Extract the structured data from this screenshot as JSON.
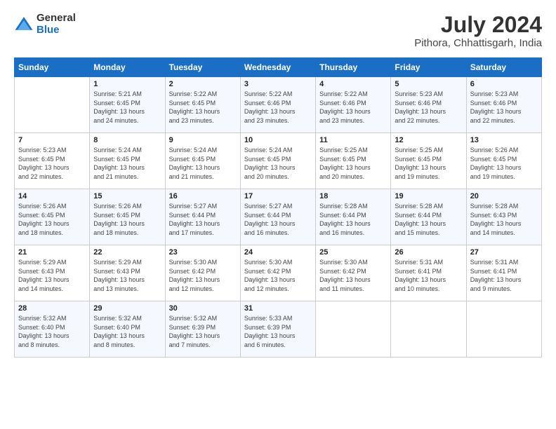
{
  "logo": {
    "general": "General",
    "blue": "Blue"
  },
  "title": "July 2024",
  "location": "Pithora, Chhattisgarh, India",
  "days_of_week": [
    "Sunday",
    "Monday",
    "Tuesday",
    "Wednesday",
    "Thursday",
    "Friday",
    "Saturday"
  ],
  "weeks": [
    [
      {
        "day": "",
        "info": ""
      },
      {
        "day": "1",
        "info": "Sunrise: 5:21 AM\nSunset: 6:45 PM\nDaylight: 13 hours\nand 24 minutes."
      },
      {
        "day": "2",
        "info": "Sunrise: 5:22 AM\nSunset: 6:45 PM\nDaylight: 13 hours\nand 23 minutes."
      },
      {
        "day": "3",
        "info": "Sunrise: 5:22 AM\nSunset: 6:46 PM\nDaylight: 13 hours\nand 23 minutes."
      },
      {
        "day": "4",
        "info": "Sunrise: 5:22 AM\nSunset: 6:46 PM\nDaylight: 13 hours\nand 23 minutes."
      },
      {
        "day": "5",
        "info": "Sunrise: 5:23 AM\nSunset: 6:46 PM\nDaylight: 13 hours\nand 22 minutes."
      },
      {
        "day": "6",
        "info": "Sunrise: 5:23 AM\nSunset: 6:46 PM\nDaylight: 13 hours\nand 22 minutes."
      }
    ],
    [
      {
        "day": "7",
        "info": "Sunrise: 5:23 AM\nSunset: 6:45 PM\nDaylight: 13 hours\nand 22 minutes."
      },
      {
        "day": "8",
        "info": "Sunrise: 5:24 AM\nSunset: 6:45 PM\nDaylight: 13 hours\nand 21 minutes."
      },
      {
        "day": "9",
        "info": "Sunrise: 5:24 AM\nSunset: 6:45 PM\nDaylight: 13 hours\nand 21 minutes."
      },
      {
        "day": "10",
        "info": "Sunrise: 5:24 AM\nSunset: 6:45 PM\nDaylight: 13 hours\nand 20 minutes."
      },
      {
        "day": "11",
        "info": "Sunrise: 5:25 AM\nSunset: 6:45 PM\nDaylight: 13 hours\nand 20 minutes."
      },
      {
        "day": "12",
        "info": "Sunrise: 5:25 AM\nSunset: 6:45 PM\nDaylight: 13 hours\nand 19 minutes."
      },
      {
        "day": "13",
        "info": "Sunrise: 5:26 AM\nSunset: 6:45 PM\nDaylight: 13 hours\nand 19 minutes."
      }
    ],
    [
      {
        "day": "14",
        "info": "Sunrise: 5:26 AM\nSunset: 6:45 PM\nDaylight: 13 hours\nand 18 minutes."
      },
      {
        "day": "15",
        "info": "Sunrise: 5:26 AM\nSunset: 6:45 PM\nDaylight: 13 hours\nand 18 minutes."
      },
      {
        "day": "16",
        "info": "Sunrise: 5:27 AM\nSunset: 6:44 PM\nDaylight: 13 hours\nand 17 minutes."
      },
      {
        "day": "17",
        "info": "Sunrise: 5:27 AM\nSunset: 6:44 PM\nDaylight: 13 hours\nand 16 minutes."
      },
      {
        "day": "18",
        "info": "Sunrise: 5:28 AM\nSunset: 6:44 PM\nDaylight: 13 hours\nand 16 minutes."
      },
      {
        "day": "19",
        "info": "Sunrise: 5:28 AM\nSunset: 6:44 PM\nDaylight: 13 hours\nand 15 minutes."
      },
      {
        "day": "20",
        "info": "Sunrise: 5:28 AM\nSunset: 6:43 PM\nDaylight: 13 hours\nand 14 minutes."
      }
    ],
    [
      {
        "day": "21",
        "info": "Sunrise: 5:29 AM\nSunset: 6:43 PM\nDaylight: 13 hours\nand 14 minutes."
      },
      {
        "day": "22",
        "info": "Sunrise: 5:29 AM\nSunset: 6:43 PM\nDaylight: 13 hours\nand 13 minutes."
      },
      {
        "day": "23",
        "info": "Sunrise: 5:30 AM\nSunset: 6:42 PM\nDaylight: 13 hours\nand 12 minutes."
      },
      {
        "day": "24",
        "info": "Sunrise: 5:30 AM\nSunset: 6:42 PM\nDaylight: 13 hours\nand 12 minutes."
      },
      {
        "day": "25",
        "info": "Sunrise: 5:30 AM\nSunset: 6:42 PM\nDaylight: 13 hours\nand 11 minutes."
      },
      {
        "day": "26",
        "info": "Sunrise: 5:31 AM\nSunset: 6:41 PM\nDaylight: 13 hours\nand 10 minutes."
      },
      {
        "day": "27",
        "info": "Sunrise: 5:31 AM\nSunset: 6:41 PM\nDaylight: 13 hours\nand 9 minutes."
      }
    ],
    [
      {
        "day": "28",
        "info": "Sunrise: 5:32 AM\nSunset: 6:40 PM\nDaylight: 13 hours\nand 8 minutes."
      },
      {
        "day": "29",
        "info": "Sunrise: 5:32 AM\nSunset: 6:40 PM\nDaylight: 13 hours\nand 8 minutes."
      },
      {
        "day": "30",
        "info": "Sunrise: 5:32 AM\nSunset: 6:39 PM\nDaylight: 13 hours\nand 7 minutes."
      },
      {
        "day": "31",
        "info": "Sunrise: 5:33 AM\nSunset: 6:39 PM\nDaylight: 13 hours\nand 6 minutes."
      },
      {
        "day": "",
        "info": ""
      },
      {
        "day": "",
        "info": ""
      },
      {
        "day": "",
        "info": ""
      }
    ]
  ]
}
